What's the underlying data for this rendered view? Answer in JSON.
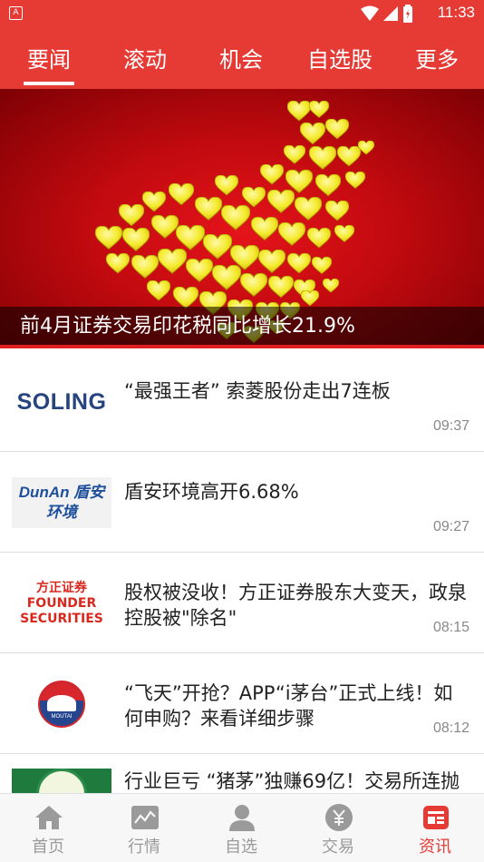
{
  "status_bar": {
    "app_indicator": "A",
    "time": "11:33"
  },
  "tabs": [
    {
      "label": "要闻",
      "active": true
    },
    {
      "label": "滚动",
      "active": false
    },
    {
      "label": "机会",
      "active": false
    },
    {
      "label": "自选股",
      "active": false
    },
    {
      "label": "更多",
      "active": false
    }
  ],
  "banner": {
    "caption": "前4月证券交易印花税同比增长21.9%"
  },
  "news": [
    {
      "logo": "SOLING",
      "title": "“最强王者” 索菱股份走出7连板",
      "time": "09:37"
    },
    {
      "logo": "DunAn 盾安环境",
      "title": "盾安环境高开6.68%",
      "time": "09:27"
    },
    {
      "logo": "方正证券 FOUNDER SECURITIES",
      "title": "股权被没收！方正证券股东大变天，政泉控股被\"除名\"",
      "time": "08:15"
    },
    {
      "logo": "MOUTAI",
      "title": "“飞天”开抢？APP“i茅台”正式上线！如何申购？来看详细步骤",
      "time": "08:12"
    },
    {
      "logo": "",
      "title": "行业巨亏 “猪茅”独赚69亿！交易所连抛",
      "time": ""
    }
  ],
  "bottom_nav": [
    {
      "label": "首页",
      "icon": "home-icon",
      "active": false
    },
    {
      "label": "行情",
      "icon": "chart-icon",
      "active": false
    },
    {
      "label": "自选",
      "icon": "person-icon",
      "active": false
    },
    {
      "label": "交易",
      "icon": "yuan-coin-icon",
      "active": false
    },
    {
      "label": "资讯",
      "icon": "news-icon",
      "active": true
    }
  ],
  "colors": {
    "brand_red": "#e63a35",
    "inactive_gray": "#9a9a9a"
  }
}
